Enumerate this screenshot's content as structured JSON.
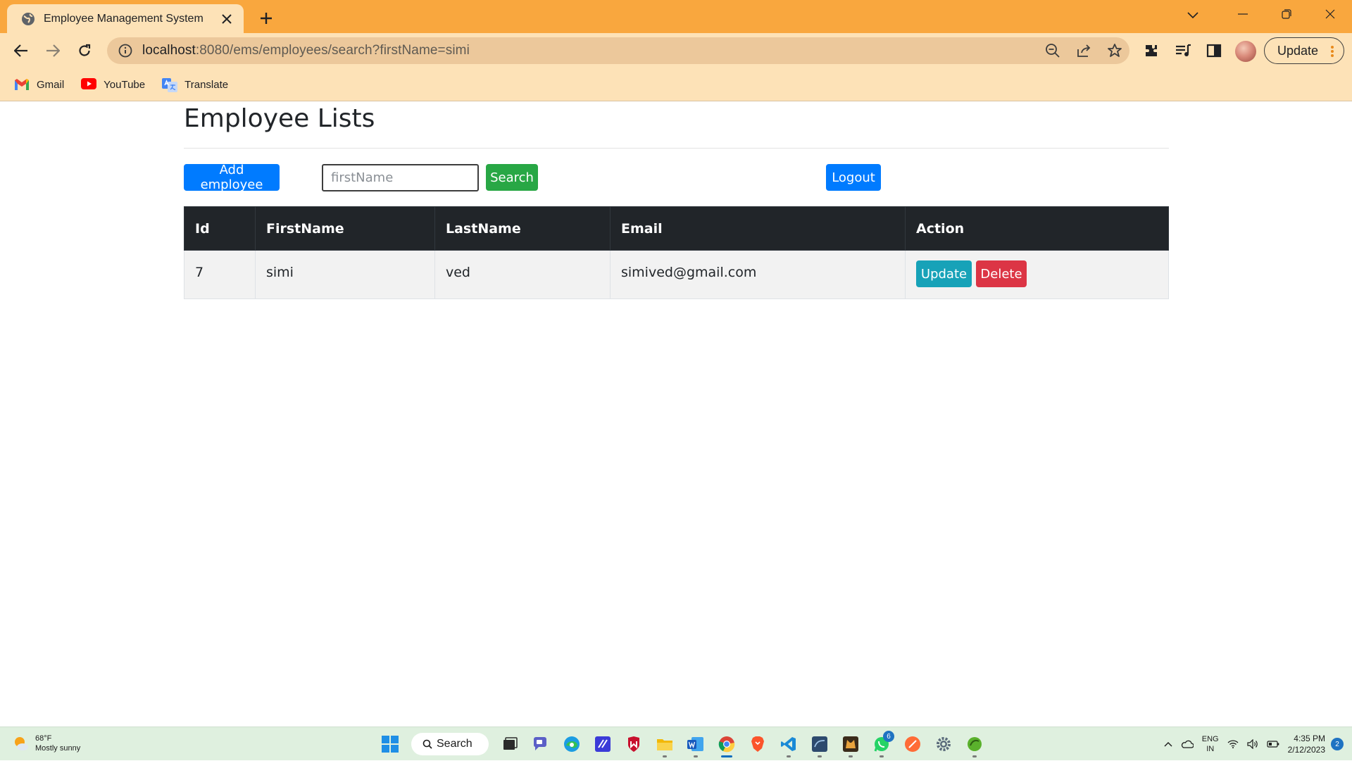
{
  "browser": {
    "tab_title": "Employee Management System",
    "url_host": "localhost",
    "url_path": ":8080/ems/employees/search?firstName=simi",
    "update_label": "Update",
    "bookmarks": [
      {
        "label": "Gmail",
        "icon": "gmail-icon"
      },
      {
        "label": "YouTube",
        "icon": "youtube-icon"
      },
      {
        "label": "Translate",
        "icon": "translate-icon"
      }
    ],
    "colors": {
      "tabstrip": "#f9a73e",
      "toolbar": "#fde2b7"
    }
  },
  "page": {
    "title": "Employee Lists",
    "add_button": "Add employee",
    "search_placeholder": "firstName",
    "search_button": "Search",
    "logout_button": "Logout"
  },
  "table": {
    "headers": [
      "Id",
      "FirstName",
      "LastName",
      "Email",
      "Action"
    ],
    "rows": [
      {
        "id": "7",
        "first_name": "simi",
        "last_name": "ved",
        "email": "simived@gmail.com",
        "update_label": "Update",
        "delete_label": "Delete"
      }
    ]
  },
  "taskbar": {
    "weather_temp": "68°F",
    "weather_desc": "Mostly sunny",
    "search_label": "Search",
    "whatsapp_badge": "6",
    "lang_top": "ENG",
    "lang_bottom": "IN",
    "time": "4:35 PM",
    "date": "2/12/2023",
    "notifications": "2"
  }
}
